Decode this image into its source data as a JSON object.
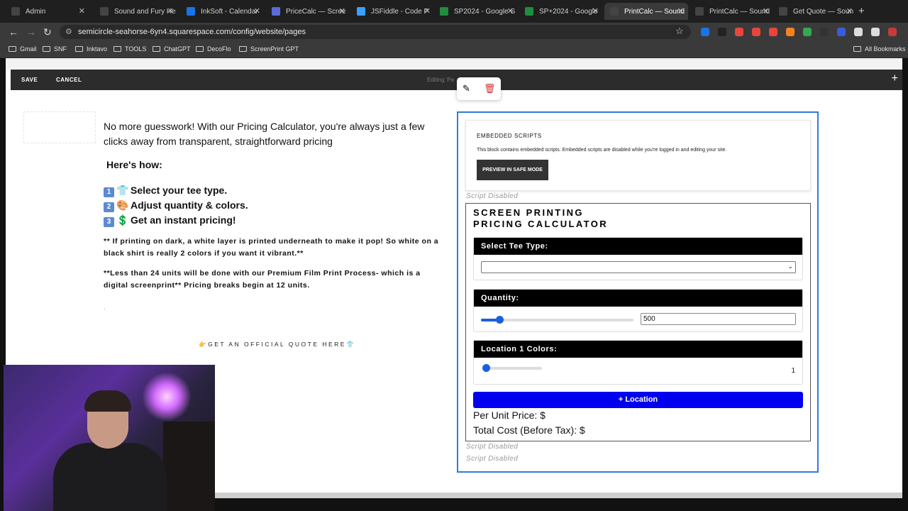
{
  "browser": {
    "tabs": [
      {
        "label": "Admin",
        "icon": "squarespace-icon",
        "color": "#444444",
        "active": false
      },
      {
        "label": "Sound and Fury He",
        "icon": "squarespace-icon",
        "color": "#444444",
        "active": false
      },
      {
        "label": "InkSoft - Calendar",
        "icon": "calendar-icon",
        "color": "#1a73e8",
        "active": false
      },
      {
        "label": "PriceCalc — Scree",
        "icon": "chatgpt-icon",
        "color": "#5b6bd8",
        "active": false
      },
      {
        "label": "JSFiddle - Code P",
        "icon": "jsfiddle-icon",
        "color": "#3aa0ff",
        "active": false
      },
      {
        "label": "SP2024 - Google S",
        "icon": "sheets-icon",
        "color": "#1e8e3e",
        "active": false
      },
      {
        "label": "SP+2024 - Google",
        "icon": "sheets-icon",
        "color": "#1e8e3e",
        "active": false
      },
      {
        "label": "PrintCalc — Sound",
        "icon": "squarespace-icon",
        "color": "#444444",
        "active": true
      },
      {
        "label": "PrintCalc — Sound",
        "icon": "squarespace-icon",
        "color": "#444444",
        "active": false
      },
      {
        "label": "Get Quote — Soun",
        "icon": "squarespace-icon",
        "color": "#444444",
        "active": false
      }
    ],
    "new_tab": "+",
    "url": "semicircle-seahorse-6yn4.squarespace.com/config/website/pages",
    "bookmarks": [
      "Gmail",
      "SNF",
      "Inktavo",
      "TOOLS",
      "ChatGPT",
      "DecoFlo",
      "ScreenPrint GPT"
    ],
    "all_bookmarks": "All Bookmarks",
    "extension_colors": [
      "#1a73e8",
      "#222222",
      "#e8453c",
      "#e8453c",
      "#e8453c",
      "#f6821f",
      "#34a853",
      "#333333",
      "#3b5bdb",
      "#dddddd",
      "#dddddd",
      "#c53a3a"
    ]
  },
  "editor": {
    "save": "SAVE",
    "cancel": "CANCEL",
    "editing_label": "Editing 'Pa",
    "add": "+"
  },
  "content": {
    "intro": "No more guesswork! With our Pricing Calculator, you're always just a few clicks away from transparent, straightforward pricing",
    "howto": "Here's how:",
    "steps": [
      {
        "num": "1",
        "emoji": "👕",
        "text": "Select your tee type."
      },
      {
        "num": "2",
        "emoji": "🎨",
        "text": "Adjust quantity & colors."
      },
      {
        "num": "3",
        "emoji": "💲",
        "text": "Get an instant pricing!"
      }
    ],
    "note1": "** If printing on dark, a white layer is printed underneath to make it pop! So white on a black shirt is really 2 colors if you want it vibrant.**",
    "note2": "**Less than 24 units will be done with our Premium Film Print Process- which is a digital screenprint** Pricing breaks begin at 12 units.",
    "dot": ".",
    "quote_link": "👉GET AN OFFICIAL QUOTE HERE👕"
  },
  "embed": {
    "heading": "EMBEDDED SCRIPTS",
    "body": "This block contains embedded scripts. Embedded scripts are disabled while you're logged in and editing your site.",
    "button": "PREVIEW IN SAFE MODE",
    "script_disabled": "Script Disabled"
  },
  "calculator": {
    "title_line1": "SCREEN PRINTING",
    "title_line2": "PRICING CALCULATOR",
    "tee_label": "Select Tee Type:",
    "tee_value": "",
    "quantity_label": "Quantity:",
    "quantity_value": "500",
    "quantity_slider_fraction": 0.12,
    "colors_label": "Location 1 Colors:",
    "colors_value": "1",
    "colors_slider_fraction": 0.0,
    "add_location": "+ Location",
    "per_unit": "Per Unit Price: $",
    "total": "Total Cost (Before Tax): $",
    "accent": "#0000f0",
    "slider_color": "#1b5fe0"
  }
}
